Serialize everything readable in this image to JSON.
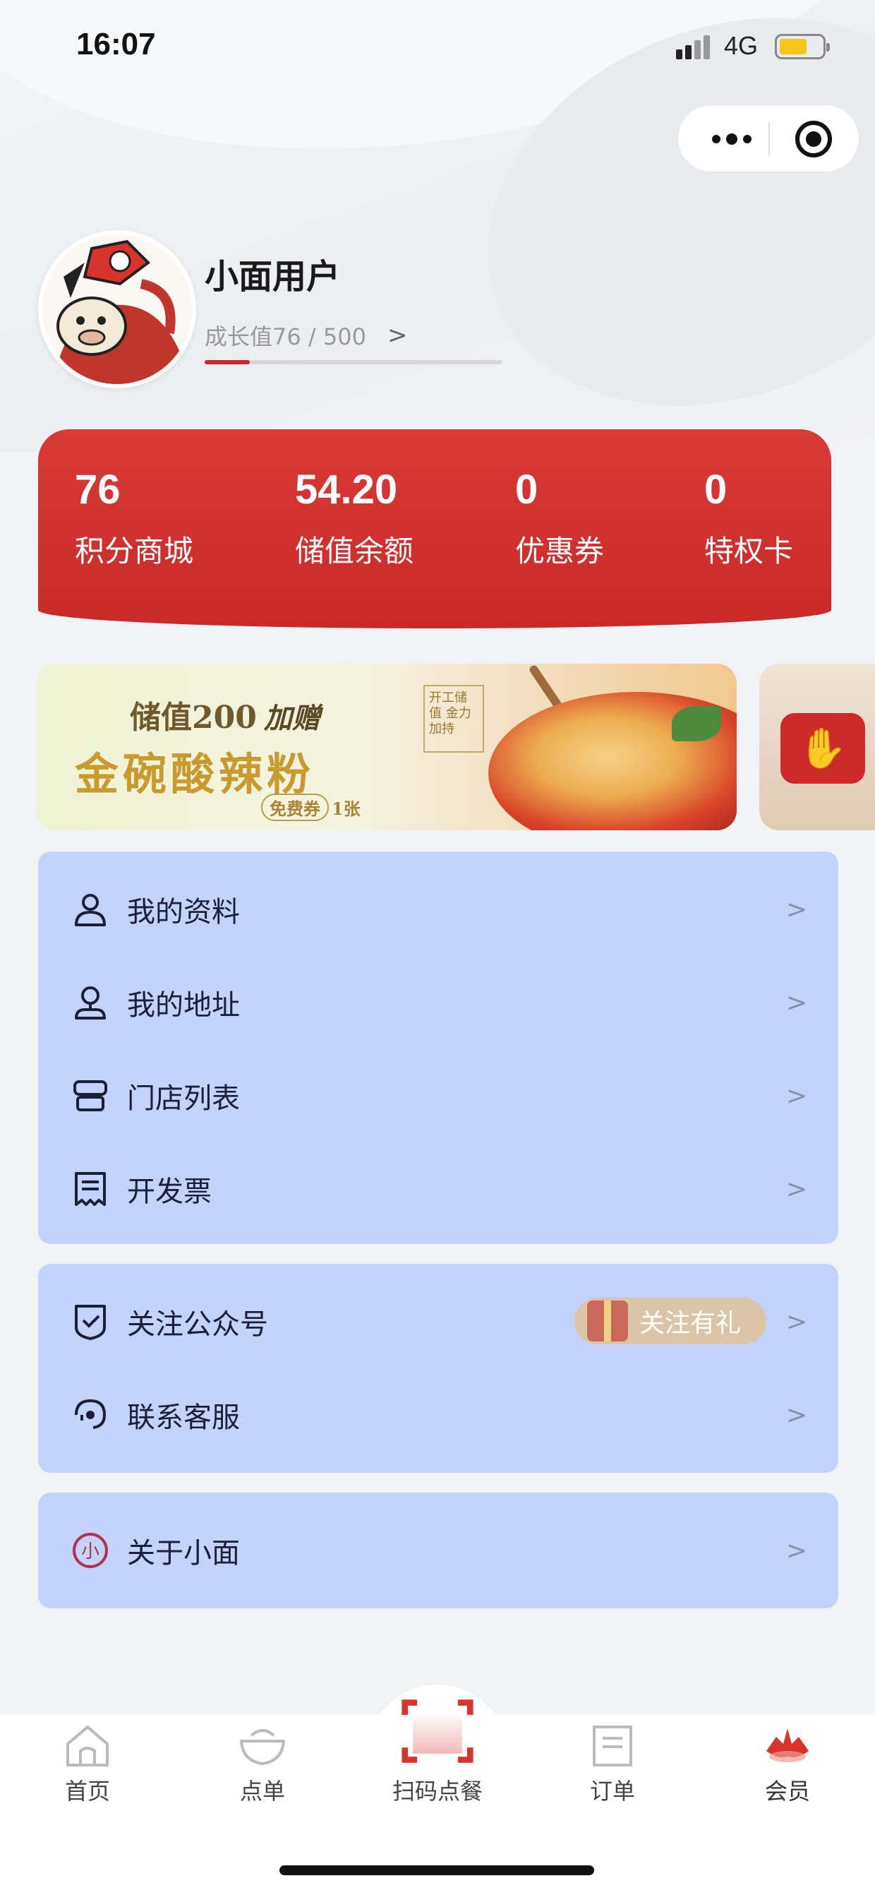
{
  "status_bar": {
    "time": "16:07",
    "network": "4G"
  },
  "profile": {
    "username": "小面用户",
    "growth_text": "成长值76 / 500",
    "growth_progress": 0.152
  },
  "stats": [
    {
      "value": "76",
      "label": "积分商城"
    },
    {
      "value": "54.20",
      "label": "储值余额"
    },
    {
      "value": "0",
      "label": "优惠券"
    },
    {
      "value": "0",
      "label": "特权卡"
    }
  ],
  "banner": {
    "line1": "储值200",
    "gift": "加赠",
    "line2": "金碗酸辣粉",
    "coupon_pill": "免费券",
    "coupon_count": "1张",
    "seal": "开工储值 金力加持"
  },
  "menu_group1": [
    {
      "label": "我的资料",
      "icon": "user-icon"
    },
    {
      "label": "我的地址",
      "icon": "location-icon"
    },
    {
      "label": "门店列表",
      "icon": "store-icon"
    },
    {
      "label": "开发票",
      "icon": "invoice-icon"
    }
  ],
  "menu_group2": [
    {
      "label": "关注公众号",
      "icon": "follow-icon",
      "badge": "关注有礼"
    },
    {
      "label": "联系客服",
      "icon": "customer-service-icon"
    }
  ],
  "menu_group3": [
    {
      "label": "关于小面",
      "icon": "brand-logo-icon",
      "logo_text": "小"
    }
  ],
  "tabs": [
    {
      "label": "首页",
      "icon": "home-icon"
    },
    {
      "label": "点单",
      "icon": "bowl-icon"
    },
    {
      "label": "扫码点餐",
      "icon": "scan-icon"
    },
    {
      "label": "订单",
      "icon": "order-icon"
    },
    {
      "label": "会员",
      "icon": "member-icon",
      "active": true
    }
  ],
  "colors": {
    "brand_red": "#c8282a",
    "menu_bg": "#c4d3fd",
    "text_dark": "#1c1f3a"
  }
}
